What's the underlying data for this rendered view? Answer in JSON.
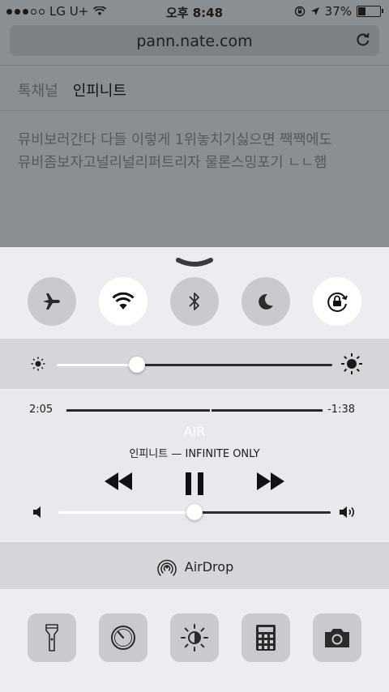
{
  "status_bar": {
    "carrier": "LG U+",
    "time": "오후 8:48",
    "battery": "37%"
  },
  "browser": {
    "url": "pann.nate.com",
    "tabs": [
      {
        "label": "톡채널",
        "active": false
      },
      {
        "label": "인피니트",
        "active": true
      }
    ],
    "article_lines": [
      "뮤비보러간다 다들 이렇게 1위놓치기싫으면 짹짹에도",
      "뮤비좀보자고널리널리퍼트리자 물론스밍포기 ㄴㄴ햄"
    ]
  },
  "control_center": {
    "toggles": [
      {
        "name": "airplane-mode",
        "icon": "airplane-icon",
        "on": false
      },
      {
        "name": "wifi",
        "icon": "wifi-icon",
        "on": true
      },
      {
        "name": "bluetooth",
        "icon": "bluetooth-icon",
        "on": false
      },
      {
        "name": "do-not-disturb",
        "icon": "moon-icon",
        "on": false
      },
      {
        "name": "rotation-lock",
        "icon": "rotation-lock-icon",
        "on": true
      }
    ],
    "brightness_level": 0.29,
    "media": {
      "elapsed": "2:05",
      "remaining": "-1:38",
      "progress": 0.56,
      "song_title": "AIR",
      "artist_album": "인피니트 — INFINITE ONLY",
      "volume_level": 0.5
    },
    "airdrop_label": "AirDrop",
    "shortcuts": [
      {
        "name": "flashlight",
        "icon": "flashlight-icon"
      },
      {
        "name": "timer",
        "icon": "timer-icon"
      },
      {
        "name": "night-shift",
        "icon": "night-shift-icon"
      },
      {
        "name": "calculator",
        "icon": "calculator-icon"
      },
      {
        "name": "camera",
        "icon": "camera-icon"
      }
    ],
    "colors": {
      "toggle_on": "#ffffff",
      "toggle_off": "#c8cace",
      "panel": "#ecedf0",
      "band": "#d4d6da"
    }
  }
}
